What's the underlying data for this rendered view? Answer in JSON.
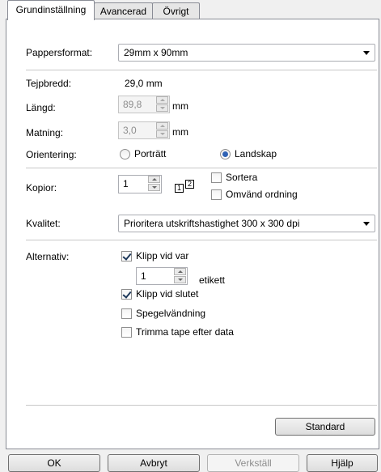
{
  "tabs": [
    "Grundinställning",
    "Avancerad",
    "Övrigt"
  ],
  "paper": {
    "label": "Pappersformat:",
    "value": "29mm x 90mm"
  },
  "tape_width": {
    "label": "Tejpbredd:",
    "value": "29,0 mm"
  },
  "length": {
    "label": "Längd:",
    "value": "89,8",
    "unit": "mm"
  },
  "feed": {
    "label": "Matning:",
    "value": "3,0",
    "unit": "mm"
  },
  "orientation": {
    "label": "Orientering:",
    "portrait": "Porträtt",
    "landscape": "Landskap",
    "selected": "Landskap"
  },
  "copies": {
    "label": "Kopior:",
    "value": "1",
    "icon_text_1": "1",
    "icon_text_2": "2",
    "sort_label": "Sortera",
    "reverse_label": "Omvänd ordning"
  },
  "quality": {
    "label": "Kvalitet:",
    "value": "Prioritera utskriftshastighet 300 x 300 dpi"
  },
  "options": {
    "label": "Alternativ:",
    "cut_every_label": "Klipp vid var",
    "cut_every_checked": true,
    "cut_every_value": "1",
    "label_unit": "etikett",
    "cut_end_label": "Klipp vid slutet",
    "cut_end_checked": true,
    "mirror_label": "Spegelvändning",
    "mirror_checked": false,
    "trim_label": "Trimma tape efter data",
    "trim_checked": false
  },
  "default_button": "Standard",
  "buttons": {
    "ok": "OK",
    "cancel": "Avbryt",
    "apply": "Verkställ",
    "help": "Hjälp"
  }
}
